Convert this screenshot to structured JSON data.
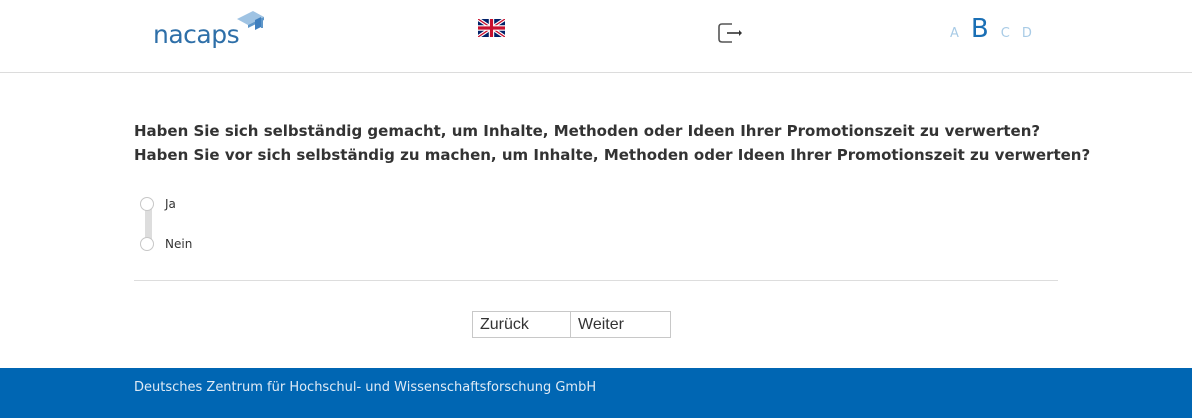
{
  "header": {
    "logo_text": "nacaps",
    "language_flag": "uk-flag-icon",
    "logout": "logout-icon",
    "variants": [
      {
        "label": "A",
        "active": false
      },
      {
        "label": "B",
        "active": true
      },
      {
        "label": "C",
        "active": false
      },
      {
        "label": "D",
        "active": false
      }
    ]
  },
  "question": {
    "line1": "Haben Sie sich selbständig gemacht, um Inhalte, Methoden oder Ideen Ihrer Promotionszeit zu verwerten?",
    "line2": "Haben Sie vor sich selbständig zu machen, um Inhalte, Methoden oder Ideen Ihrer Promotionszeit zu verwerten?"
  },
  "answers": [
    {
      "label": "Ja",
      "selected": false
    },
    {
      "label": "Nein",
      "selected": false
    }
  ],
  "nav": {
    "back_label": "Zurück",
    "next_label": "Weiter"
  },
  "footer": {
    "text": "Deutsches Zentrum für Hochschul- und Wissenschaftsforschung GmbH"
  },
  "colors": {
    "brand": "#0066b3",
    "logo": "#2e6fa8",
    "variant_inactive": "#a8cbe6",
    "variant_active": "#1a6fb5"
  }
}
